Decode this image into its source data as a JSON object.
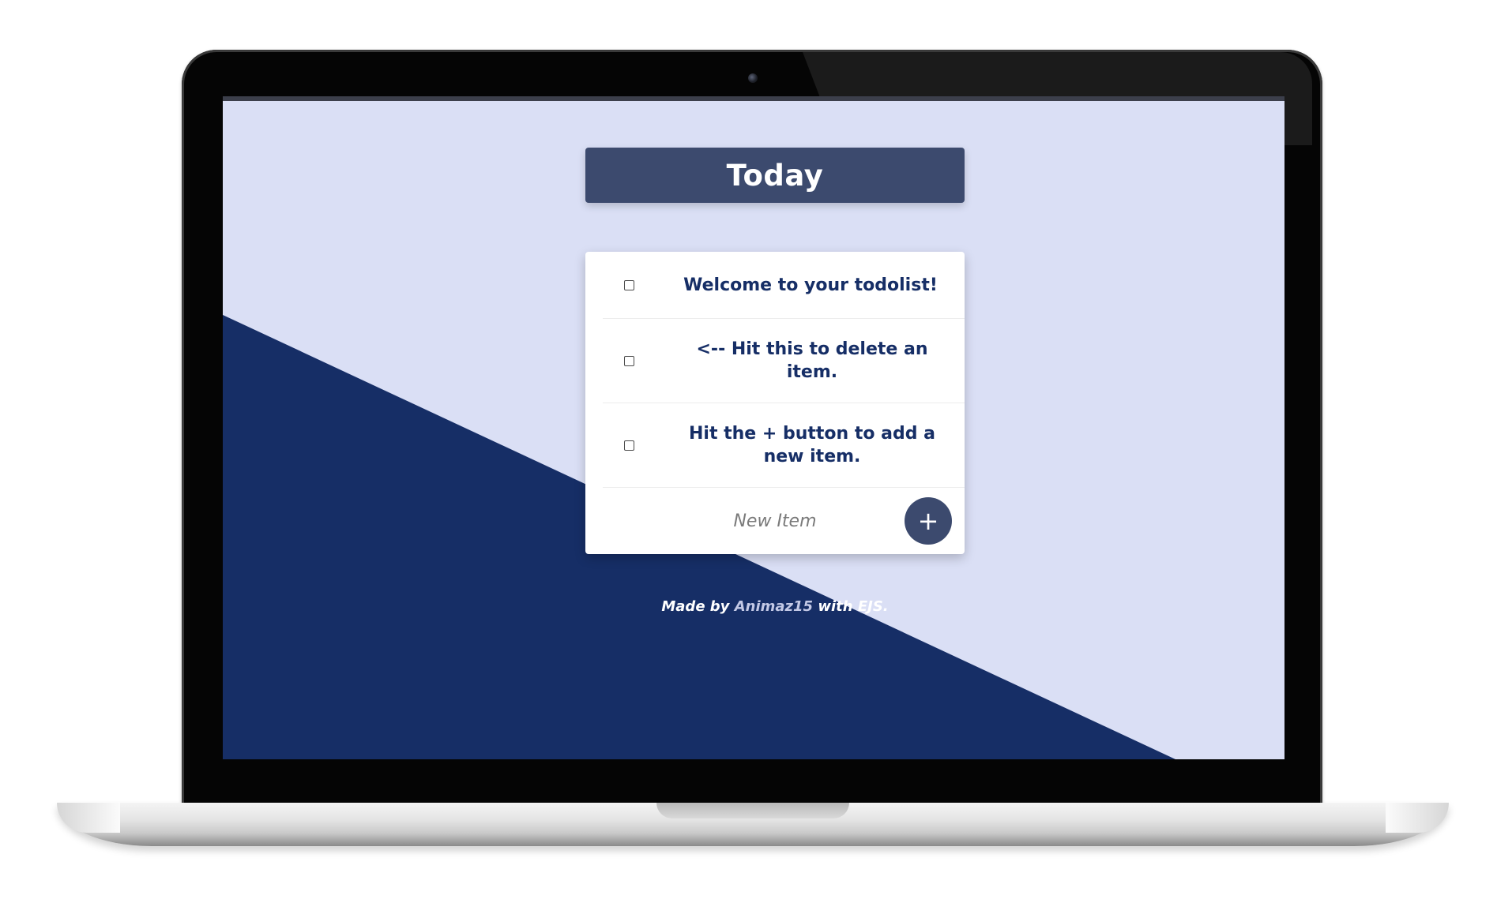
{
  "colors": {
    "screen_background": "#dadff5",
    "diagonal_navy": "#162e66",
    "heading_background": "#3c4a6e",
    "item_text": "#162e66",
    "add_button": "#3c4a6e"
  },
  "app": {
    "title": "Today",
    "items": [
      {
        "label": "Welcome to your todolist!",
        "checked": false
      },
      {
        "label": "<-- Hit this to delete an item.",
        "checked": false
      },
      {
        "label": "Hit the + button to add a new item.",
        "checked": false
      }
    ],
    "new_item": {
      "placeholder": "New Item",
      "value": "",
      "add_button_label": "+"
    },
    "footer": {
      "prefix": "Made by",
      "author": "Animaz15",
      "middle": "with",
      "tech": "EJS."
    }
  }
}
